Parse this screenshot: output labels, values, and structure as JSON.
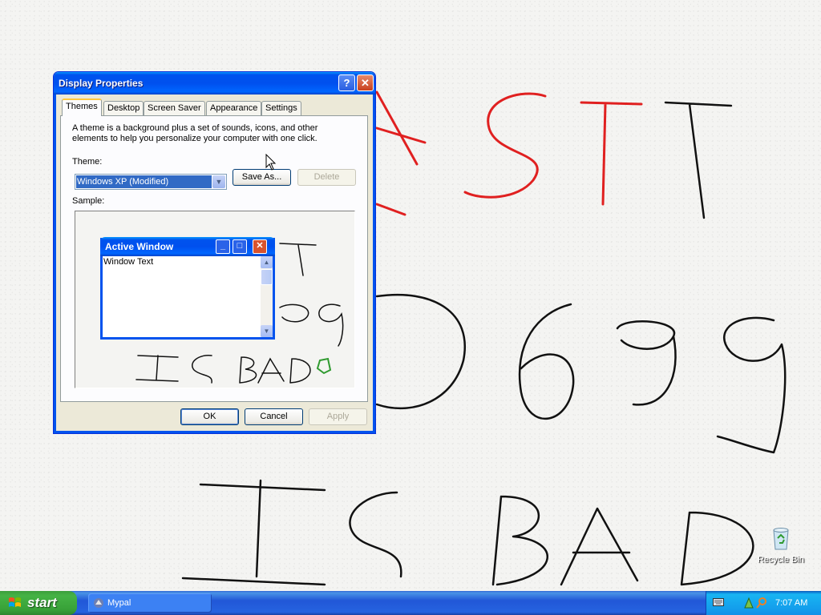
{
  "window": {
    "title": "Display Properties",
    "help_label": "?",
    "close_label": "✕"
  },
  "tabs": [
    {
      "label": "Themes",
      "active": true
    },
    {
      "label": "Desktop",
      "active": false
    },
    {
      "label": "Screen Saver",
      "active": false
    },
    {
      "label": "Appearance",
      "active": false
    },
    {
      "label": "Settings",
      "active": false
    }
  ],
  "themes_panel": {
    "description": "A theme is a background plus a set of sounds, icons, and other elements to help you personalize your computer with one click.",
    "theme_label": "Theme:",
    "theme_value": "Windows XP (Modified)",
    "save_as_label": "Save As...",
    "delete_label": "Delete",
    "sample_label": "Sample:"
  },
  "sample_window": {
    "title": "Active Window",
    "body_text": "Window Text"
  },
  "dialog_buttons": {
    "ok": "OK",
    "cancel": "Cancel",
    "apply": "Apply"
  },
  "desktop": {
    "recycle_bin_label": "Recycle Bin"
  },
  "taskbar": {
    "start_label": "start",
    "tasks": [
      {
        "label": "Mypal"
      }
    ],
    "clock": "7:07 AM"
  },
  "colors": {
    "xp_blue": "#0053ee",
    "start_green": "#3c9e3c",
    "doodle_red": "#e02020",
    "doodle_black": "#111111"
  }
}
